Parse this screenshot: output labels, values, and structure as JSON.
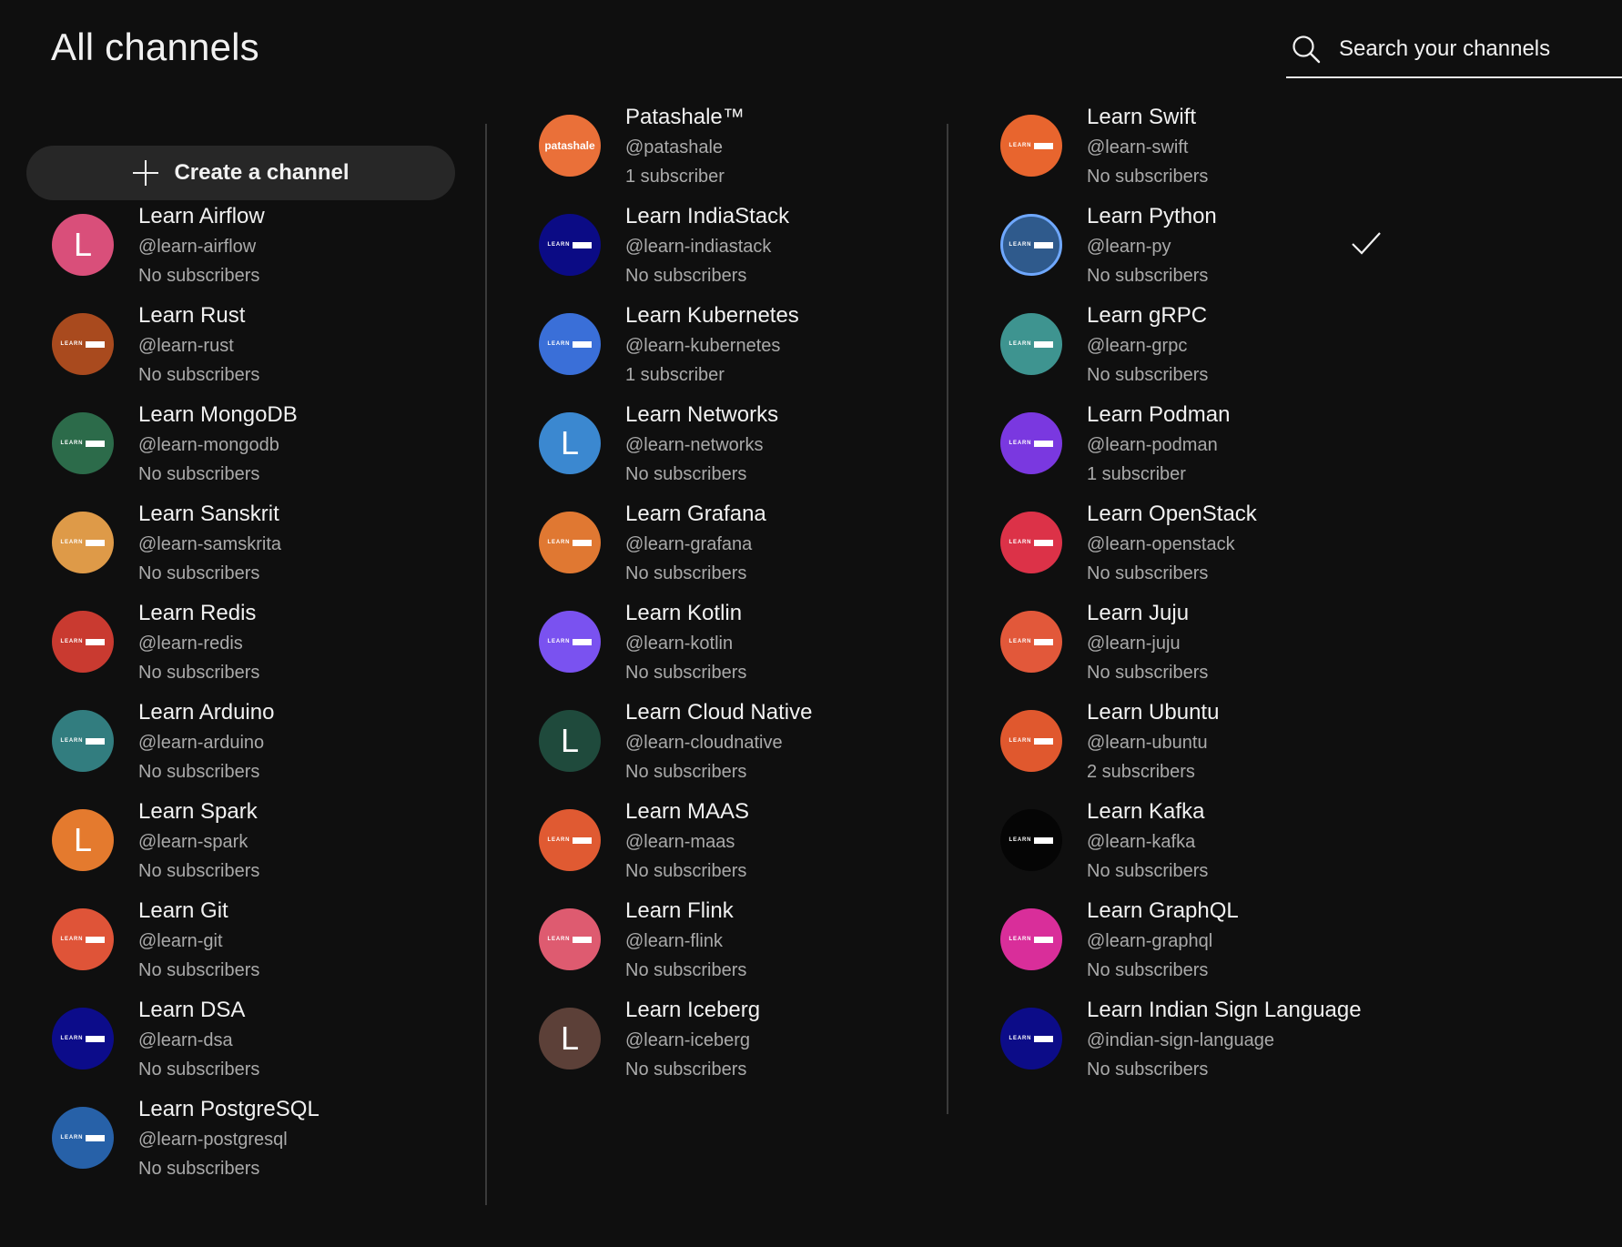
{
  "header": {
    "title": "All channels",
    "search": {
      "placeholder": "Search your channels",
      "value": ""
    }
  },
  "create_button": {
    "label": "Create a channel"
  },
  "columns": [
    [
      {
        "name": "Learn Airflow",
        "handle": "@learn-airflow",
        "subs": "No subscribers",
        "avatar": {
          "type": "letter",
          "text": "L",
          "color": "#d94f7a"
        }
      },
      {
        "name": "Learn Rust",
        "handle": "@learn-rust",
        "subs": "No subscribers",
        "avatar": {
          "type": "logo",
          "text": "LEARN",
          "color": "#a94a1e"
        }
      },
      {
        "name": "Learn MongoDB",
        "handle": "@learn-mongodb",
        "subs": "No subscribers",
        "avatar": {
          "type": "logo",
          "text": "LEARN",
          "color": "#2c6b4a"
        }
      },
      {
        "name": "Learn Sanskrit",
        "handle": "@learn-samskrita",
        "subs": "No subscribers",
        "avatar": {
          "type": "logo",
          "text": "LEARN",
          "color": "#de9a48"
        }
      },
      {
        "name": "Learn Redis",
        "handle": "@learn-redis",
        "subs": "No subscribers",
        "avatar": {
          "type": "logo",
          "text": "LEARN",
          "color": "#c93a30"
        }
      },
      {
        "name": "Learn Arduino",
        "handle": "@learn-arduino",
        "subs": "No subscribers",
        "avatar": {
          "type": "logo",
          "text": "LEARN",
          "color": "#327d7f"
        }
      },
      {
        "name": "Learn Spark",
        "handle": "@learn-spark",
        "subs": "No subscribers",
        "avatar": {
          "type": "letter",
          "text": "L",
          "color": "#e47a2e"
        }
      },
      {
        "name": "Learn Git",
        "handle": "@learn-git",
        "subs": "No subscribers",
        "avatar": {
          "type": "logo",
          "text": "LEARN",
          "color": "#df5438"
        }
      },
      {
        "name": "Learn DSA",
        "handle": "@learn-dsa",
        "subs": "No subscribers",
        "avatar": {
          "type": "logo",
          "text": "LEARN",
          "color": "#0c0c8a"
        }
      },
      {
        "name": "Learn PostgreSQL",
        "handle": "@learn-postgresql",
        "subs": "No subscribers",
        "avatar": {
          "type": "logo",
          "text": "LEARN",
          "color": "#2761a8"
        }
      }
    ],
    [
      {
        "name": "Patashale™",
        "handle": "@patashale",
        "subs": "1 subscriber",
        "avatar": {
          "type": "brand",
          "text": "patashale",
          "color": "#ea7039"
        }
      },
      {
        "name": "Learn IndiaStack",
        "handle": "@learn-indiastack",
        "subs": "No subscribers",
        "avatar": {
          "type": "logo",
          "text": "LEARN",
          "color": "#0b0b85"
        }
      },
      {
        "name": "Learn Kubernetes",
        "handle": "@learn-kubernetes",
        "subs": "1 subscriber",
        "avatar": {
          "type": "logo",
          "text": "LEARN",
          "color": "#3a6fd8"
        }
      },
      {
        "name": "Learn Networks",
        "handle": "@learn-networks",
        "subs": "No subscribers",
        "avatar": {
          "type": "letter",
          "text": "L",
          "color": "#3b88d0"
        }
      },
      {
        "name": "Learn Grafana",
        "handle": "@learn-grafana",
        "subs": "No subscribers",
        "avatar": {
          "type": "logo",
          "text": "LEARN",
          "color": "#e07832"
        }
      },
      {
        "name": "Learn Kotlin",
        "handle": "@learn-kotlin",
        "subs": "No subscribers",
        "avatar": {
          "type": "logo",
          "text": "LEARN",
          "color": "#7a52f0"
        }
      },
      {
        "name": "Learn Cloud Native",
        "handle": "@learn-cloudnative",
        "subs": "No subscribers",
        "avatar": {
          "type": "letter",
          "text": "L",
          "color": "#1f4a3c"
        }
      },
      {
        "name": "Learn MAAS",
        "handle": "@learn-maas",
        "subs": "No subscribers",
        "avatar": {
          "type": "logo",
          "text": "LEARN",
          "color": "#e05a32"
        }
      },
      {
        "name": "Learn Flink",
        "handle": "@learn-flink",
        "subs": "No subscribers",
        "avatar": {
          "type": "logo",
          "text": "LEARN",
          "color": "#de5b70"
        }
      },
      {
        "name": "Learn Iceberg",
        "handle": "@learn-iceberg",
        "subs": "No subscribers",
        "avatar": {
          "type": "letter",
          "text": "L",
          "color": "#5c4038"
        }
      }
    ],
    [
      {
        "name": "Learn Swift",
        "handle": "@learn-swift",
        "subs": "No subscribers",
        "avatar": {
          "type": "logo",
          "text": "LEARN",
          "color": "#e8652e"
        }
      },
      {
        "name": "Learn Python",
        "handle": "@learn-py",
        "subs": "No subscribers",
        "selected": true,
        "avatar": {
          "type": "logo",
          "text": "LEARN",
          "color": "#2f5a8c"
        }
      },
      {
        "name": "Learn gRPC",
        "handle": "@learn-grpc",
        "subs": "No subscribers",
        "avatar": {
          "type": "logo",
          "text": "LEARN",
          "color": "#3e9490"
        }
      },
      {
        "name": "Learn Podman",
        "handle": "@learn-podman",
        "subs": "1 subscriber",
        "avatar": {
          "type": "logo",
          "text": "LEARN",
          "color": "#7a38e0"
        }
      },
      {
        "name": "Learn OpenStack",
        "handle": "@learn-openstack",
        "subs": "No subscribers",
        "avatar": {
          "type": "logo",
          "text": "LEARN",
          "color": "#dc3248"
        }
      },
      {
        "name": "Learn Juju",
        "handle": "@learn-juju",
        "subs": "No subscribers",
        "avatar": {
          "type": "logo",
          "text": "LEARN",
          "color": "#e2583a"
        }
      },
      {
        "name": "Learn Ubuntu",
        "handle": "@learn-ubuntu",
        "subs": "2 subscribers",
        "avatar": {
          "type": "logo",
          "text": "LEARN",
          "color": "#e0582e"
        }
      },
      {
        "name": "Learn Kafka",
        "handle": "@learn-kafka",
        "subs": "No subscribers",
        "avatar": {
          "type": "logo",
          "text": "LEARN",
          "color": "#050505"
        }
      },
      {
        "name": "Learn GraphQL",
        "handle": "@learn-graphql",
        "subs": "No subscribers",
        "avatar": {
          "type": "logo",
          "text": "LEARN",
          "color": "#d92e9a"
        }
      },
      {
        "name": "Learn Indian Sign Language",
        "handle": "@indian-sign-language",
        "subs": "No subscribers",
        "avatar": {
          "type": "logo",
          "text": "LEARN",
          "color": "#0c0c88"
        }
      }
    ]
  ],
  "icons": {
    "search": "search-icon",
    "add": "plus-icon",
    "selected": "check-icon"
  }
}
